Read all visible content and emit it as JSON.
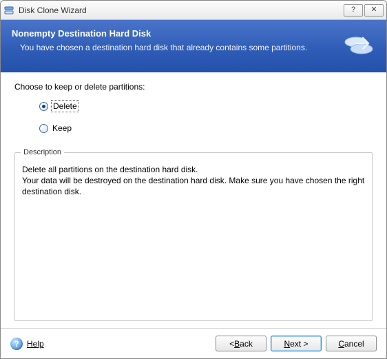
{
  "window": {
    "title": "Disk Clone Wizard"
  },
  "banner": {
    "heading": "Nonempty Destination Hard Disk",
    "subtext": "You have chosen a destination hard disk that already contains some partitions."
  },
  "content": {
    "prompt": "Choose to keep or delete partitions:",
    "options": {
      "delete": "Delete",
      "keep": "Keep",
      "selected": "delete"
    },
    "description": {
      "legend": "Description",
      "line1": "Delete all partitions on the destination hard disk.",
      "line2": "Your data will be destroyed on the destination hard disk. Make sure you have chosen the right destination disk."
    }
  },
  "footer": {
    "help": "Help",
    "back_prefix": "< ",
    "back_u": "B",
    "back_rest": "ack",
    "next_u": "N",
    "next_rest": "ext >",
    "cancel_u": "C",
    "cancel_rest": "ancel"
  },
  "icons": {
    "app": "app-icon",
    "disks": "disks-icon",
    "help": "help-icon"
  }
}
